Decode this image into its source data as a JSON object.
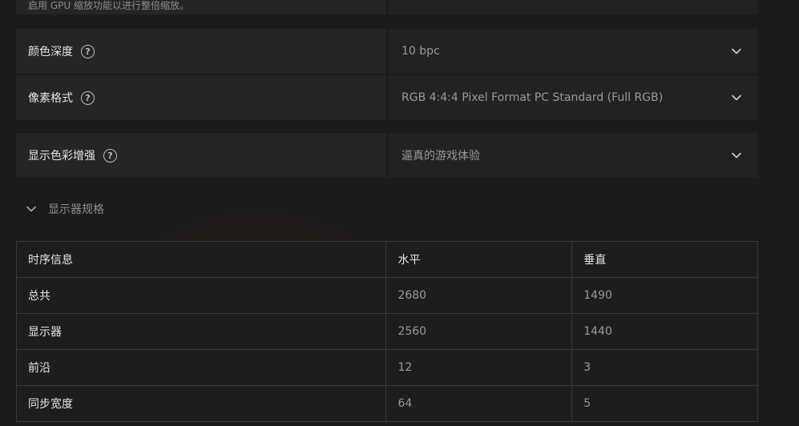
{
  "top_row": {
    "description": "启用 GPU 缩放功能以进行整倍缩放。"
  },
  "settings": [
    {
      "label": "颜色深度",
      "value": "10 bpc"
    },
    {
      "label": "像素格式",
      "value": "RGB 4:4:4 Pixel Format PC Standard (Full RGB)"
    },
    {
      "label": "显示色彩增强",
      "value": "逼真的游戏体验"
    }
  ],
  "icons": {
    "help": "question-mark-circle-icon",
    "dropdown": "chevron-down-icon",
    "collapse": "chevron-down-icon"
  },
  "section": {
    "title": "显示器规格"
  },
  "table": {
    "headers": [
      "时序信息",
      "水平",
      "垂直"
    ],
    "rows": [
      [
        "总共",
        "2680",
        "1490"
      ],
      [
        "显示器",
        "2560",
        "1440"
      ],
      [
        "前沿",
        "12",
        "3"
      ],
      [
        "同步宽度",
        "64",
        "5"
      ]
    ]
  },
  "colors": {
    "background": "#1b1b1b",
    "panel": "#252525",
    "value_panel": "#222222",
    "border": "#3b3b3b",
    "text_primary": "#e6e6e6",
    "text_secondary": "#9a9a9a"
  }
}
